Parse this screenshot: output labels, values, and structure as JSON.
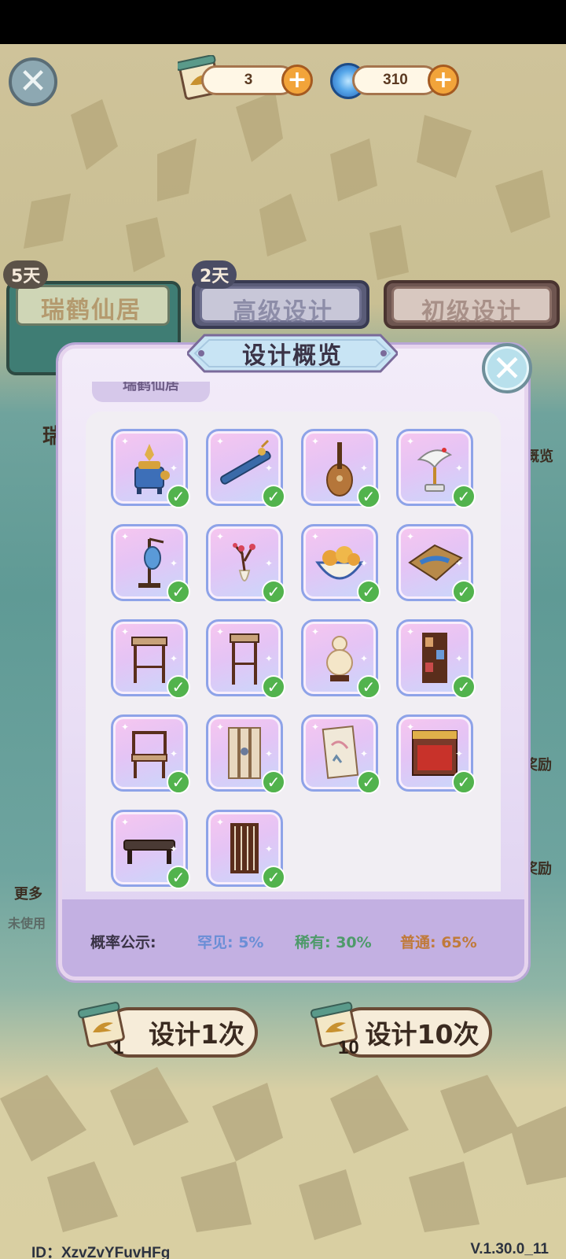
{
  "resources": {
    "scrolls": "3",
    "swirl_points": "310"
  },
  "tabs": {
    "tab1_label": "瑞鹤仙居",
    "tab1_days": "5天",
    "tab2_label": "高级设计",
    "tab2_days": "2天",
    "tab3_label": "初级设计"
  },
  "background_fragments": {
    "left_char": "瑞",
    "right_overview": "概览",
    "reward1": "奖励",
    "reward2": "奖励",
    "more": "更多",
    "unused": "未使用"
  },
  "modal": {
    "title": "设计概览",
    "subtab": "瑞鹤仙居",
    "items": [
      {
        "name": "incense-burner",
        "owned": true
      },
      {
        "name": "flute",
        "owned": true
      },
      {
        "name": "pipa",
        "owned": true
      },
      {
        "name": "crane-statue",
        "owned": true
      },
      {
        "name": "lantern-stand",
        "owned": true
      },
      {
        "name": "plum-vase",
        "owned": true
      },
      {
        "name": "fruit-bowl",
        "owned": true
      },
      {
        "name": "landscape-rug",
        "owned": true
      },
      {
        "name": "square-stool",
        "owned": true
      },
      {
        "name": "tall-stand",
        "owned": true
      },
      {
        "name": "gourd-vase",
        "owned": true
      },
      {
        "name": "curio-shelf",
        "owned": true
      },
      {
        "name": "armchair",
        "owned": true
      },
      {
        "name": "folding-screen",
        "owned": true
      },
      {
        "name": "painting-screen",
        "owned": true
      },
      {
        "name": "canopy-bed",
        "owned": true
      },
      {
        "name": "long-bench",
        "owned": true
      },
      {
        "name": "lattice-partition",
        "owned": true
      }
    ],
    "probability": {
      "label": "概率公示:",
      "rare": "罕见: 5%",
      "uncommon": "稀有: 30%",
      "common": "普通: 65%"
    },
    "colors": {
      "rare": "#6a8ed6",
      "uncommon": "#4e9a6a",
      "common": "#c07a3a"
    }
  },
  "buttons": {
    "design_once": "设计1次",
    "design_once_cost": "1",
    "design_ten": "设计10次",
    "design_ten_cost": "10"
  },
  "footer": {
    "id": "ID：XzvZvYFuvHFg",
    "version": "V.1.30.0_11"
  }
}
